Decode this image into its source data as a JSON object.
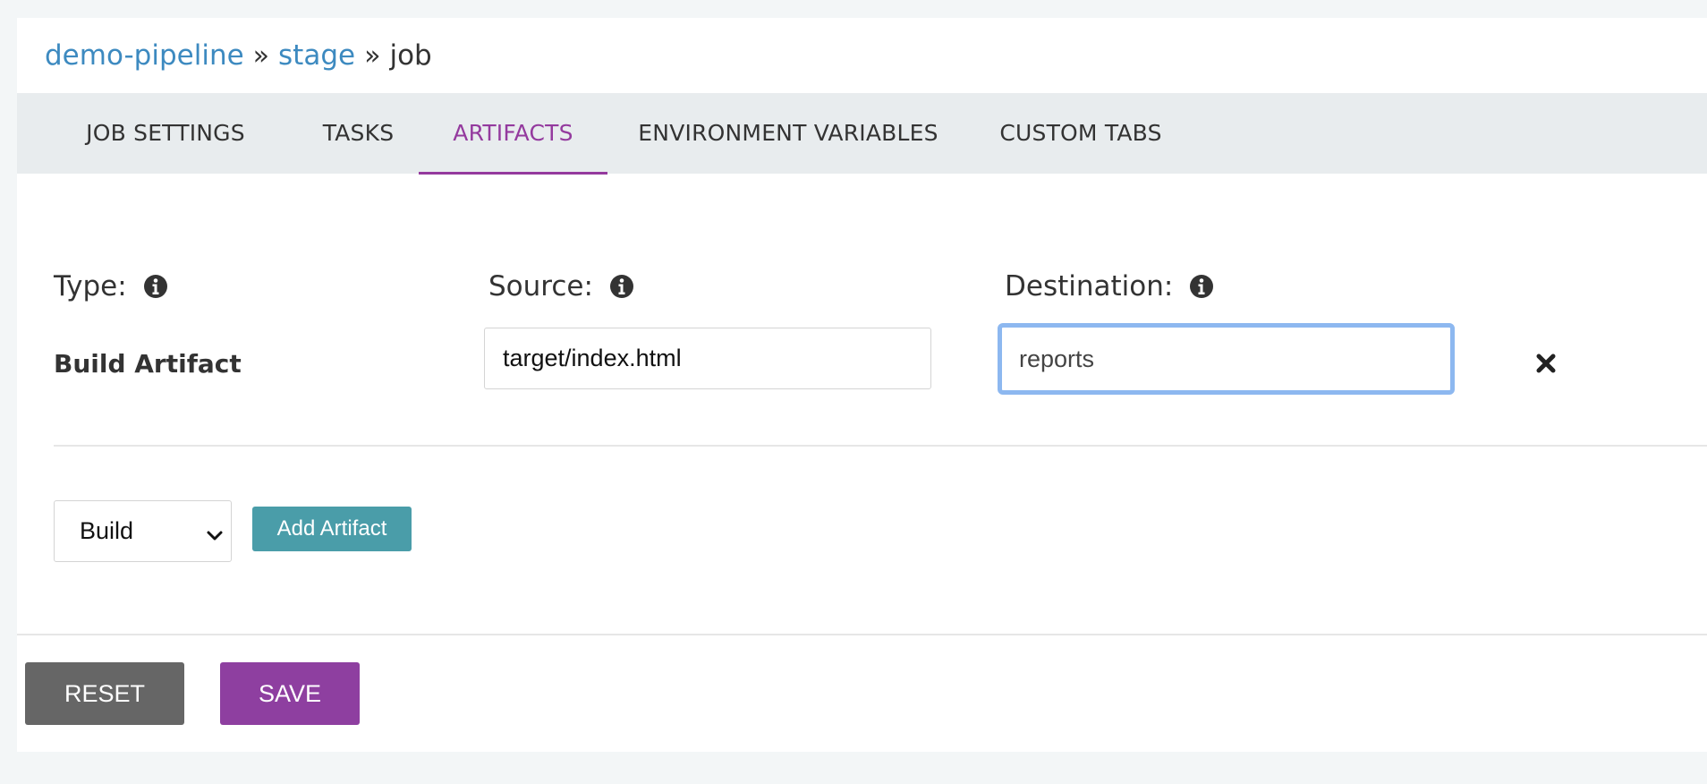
{
  "breadcrumb": {
    "pipeline": "demo-pipeline",
    "stage": "stage",
    "job": "job",
    "separator": "»"
  },
  "tabs": [
    {
      "label": "JOB SETTINGS",
      "active": false
    },
    {
      "label": "TASKS",
      "active": false
    },
    {
      "label": "ARTIFACTS",
      "active": true
    },
    {
      "label": "ENVIRONMENT VARIABLES",
      "active": false
    },
    {
      "label": "CUSTOM TABS",
      "active": false
    }
  ],
  "artifact_form": {
    "type_label": "Type:",
    "source_label": "Source:",
    "destination_label": "Destination:",
    "info_icon": "info-circle-icon",
    "row": {
      "type": "Build Artifact",
      "source": "target/index.html",
      "destination": "reports",
      "remove_icon": "close-icon"
    }
  },
  "add_section": {
    "select_value": "Build",
    "select_options": [
      "Build"
    ],
    "add_button": "Add Artifact"
  },
  "footer": {
    "reset_label": "RESET",
    "save_label": "SAVE"
  },
  "colors": {
    "link": "#3d8ac0",
    "accent_purple": "#943a9e",
    "teal_button": "#4a9da9",
    "reset_button": "#666666",
    "save_button": "#8e3fa0",
    "focus_ring": "#8db8f0"
  }
}
